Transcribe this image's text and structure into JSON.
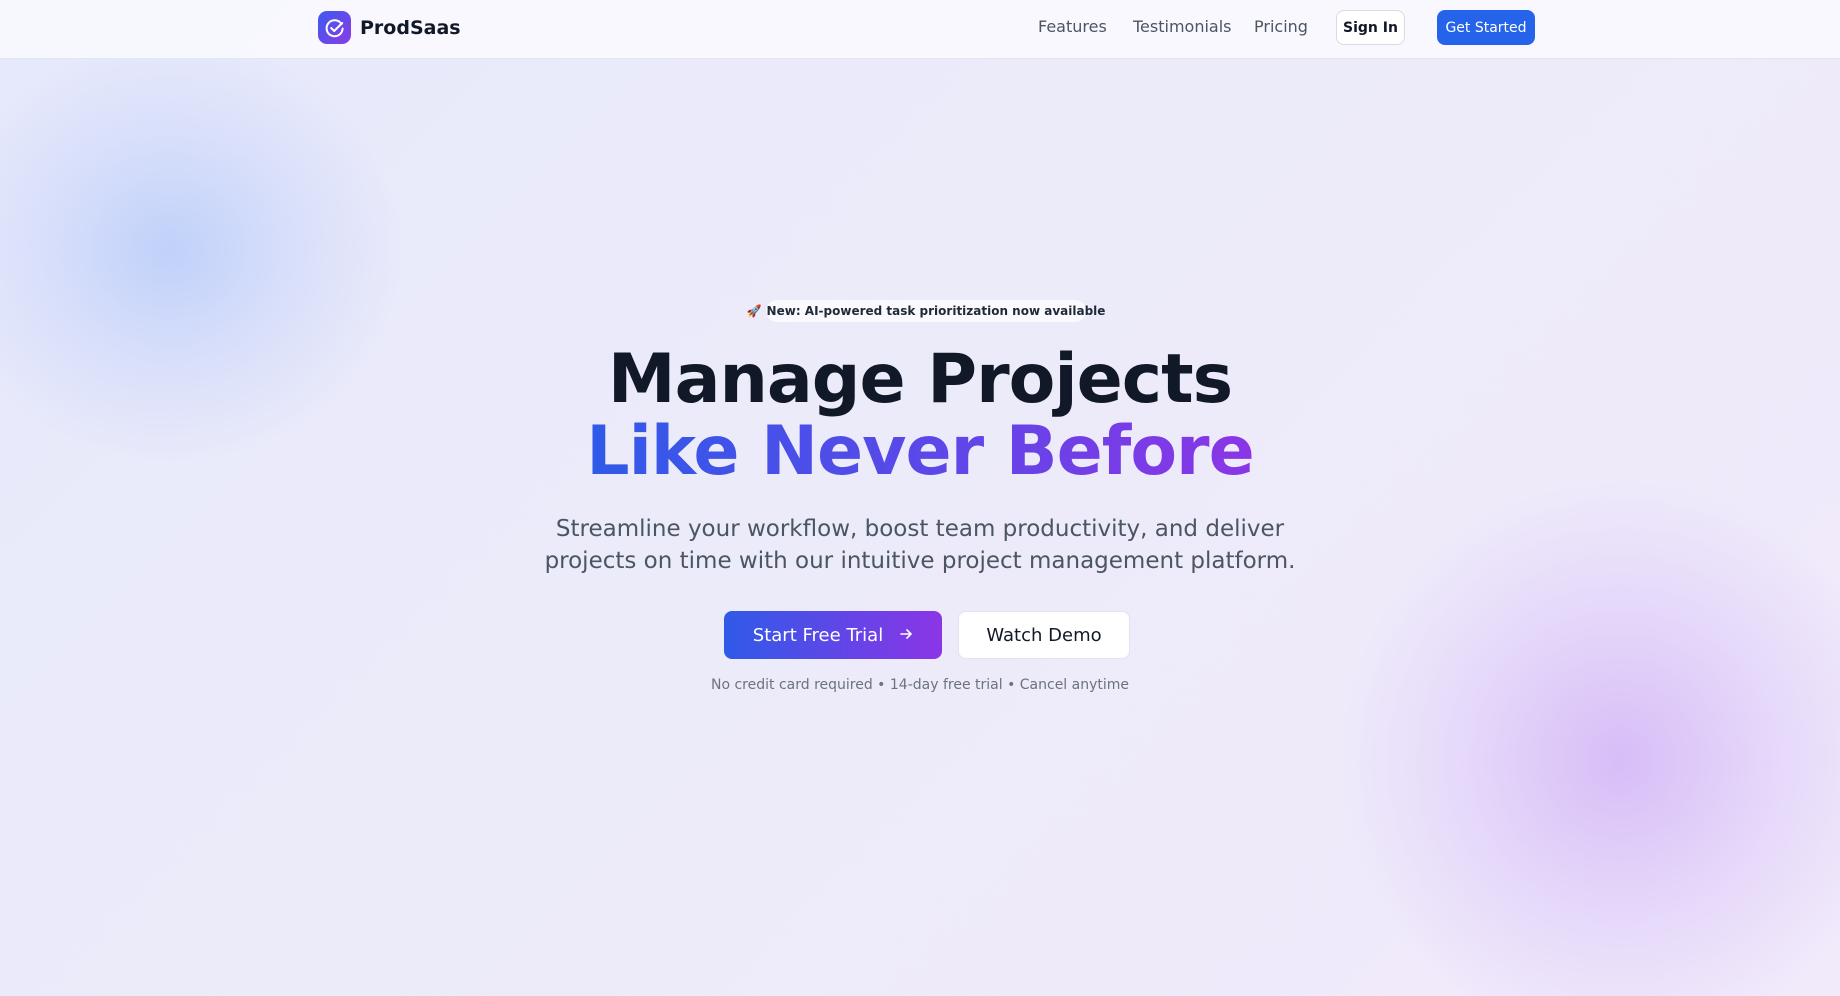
{
  "header": {
    "brand": "ProdSaas",
    "nav": [
      {
        "label": "Features"
      },
      {
        "label": "Testimonials"
      },
      {
        "label": "Pricing"
      }
    ],
    "sign_in": "Sign In",
    "get_started": "Get Started"
  },
  "hero": {
    "badge_icon": "rocket-icon",
    "badge_emoji": "🚀",
    "badge_text": "New: AI-powered task prioritization now available",
    "title_line1": "Manage Projects",
    "title_line2": "Like Never Before",
    "subtitle_line1": "Streamline your workflow, boost team productivity, and deliver",
    "subtitle_line2": "projects on time with our intuitive project management platform.",
    "primary_cta": "Start Free Trial",
    "primary_cta_icon": "arrow-right-icon",
    "secondary_cta": "Watch Demo",
    "fine_print": "No credit card required • 14-day free trial • Cancel anytime"
  },
  "colors": {
    "accent": "#2563eb",
    "gradient_start": "#2f5ae8",
    "gradient_end": "#8b35e6",
    "heading": "#111827",
    "body_text": "#4b5563"
  }
}
